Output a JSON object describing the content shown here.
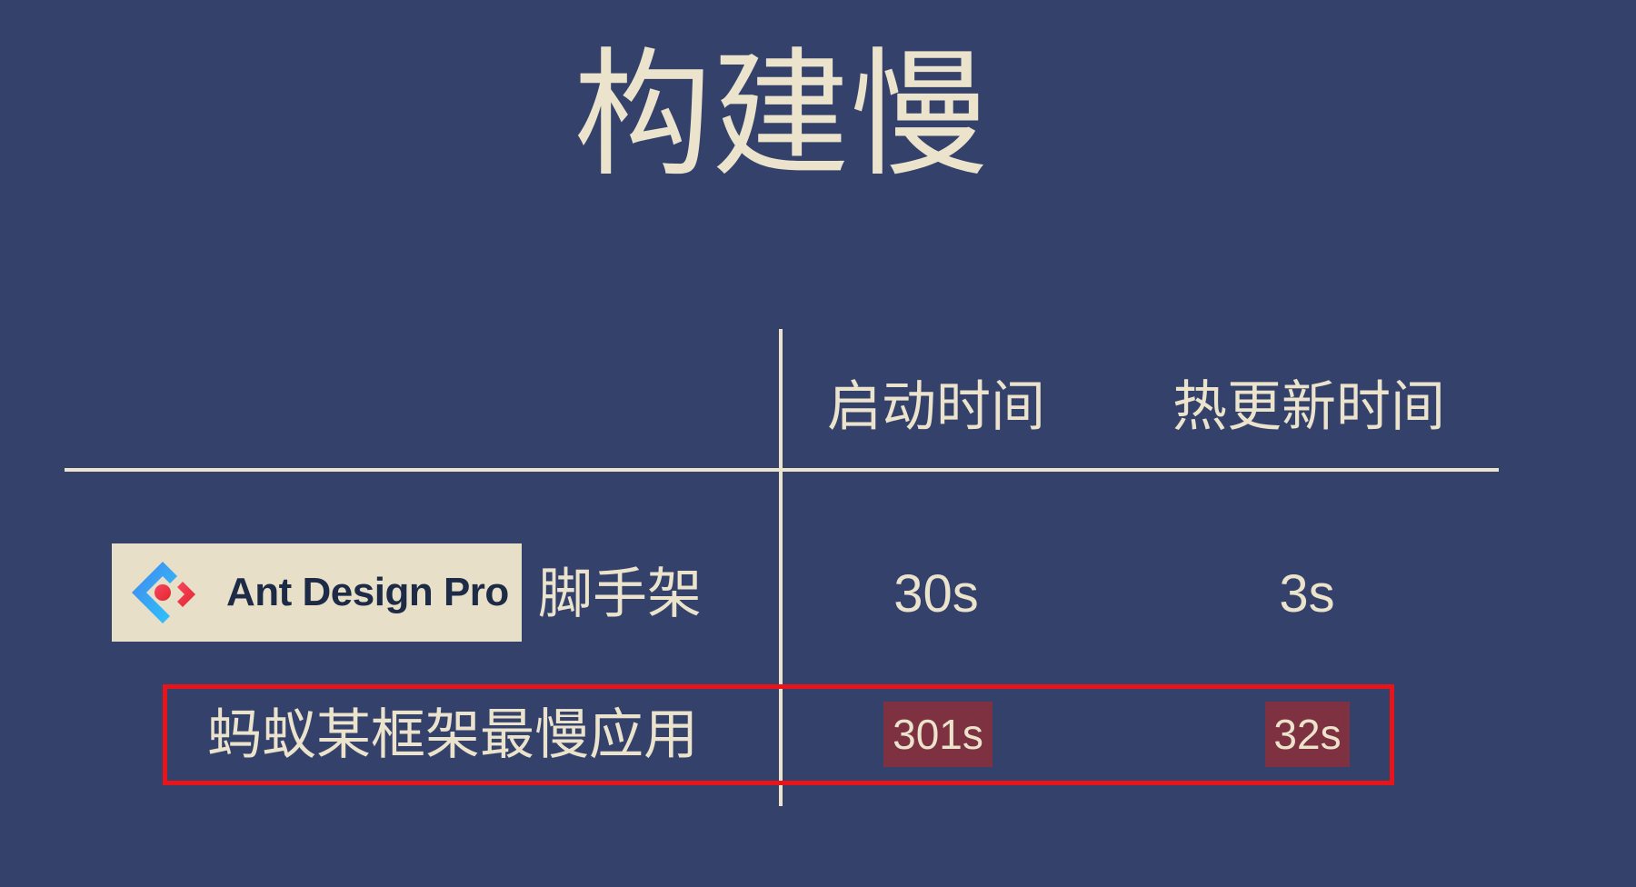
{
  "title": "构建慢",
  "columns": [
    "启动时间",
    "热更新时间"
  ],
  "rows": [
    {
      "logo_text": "Ant Design Pro",
      "label": "脚手架",
      "startup": "30s",
      "hot_update": "3s"
    },
    {
      "label": "蚂蚁某框架最慢应用",
      "startup": "301s",
      "hot_update": "32s",
      "highlighted": true
    }
  ],
  "colors": {
    "background": "#34416b",
    "foreground": "#ebe3cc",
    "highlight_border": "#e8141a",
    "value_chip": "#7d3141"
  },
  "icons": [
    "ant-design-logo-icon"
  ]
}
